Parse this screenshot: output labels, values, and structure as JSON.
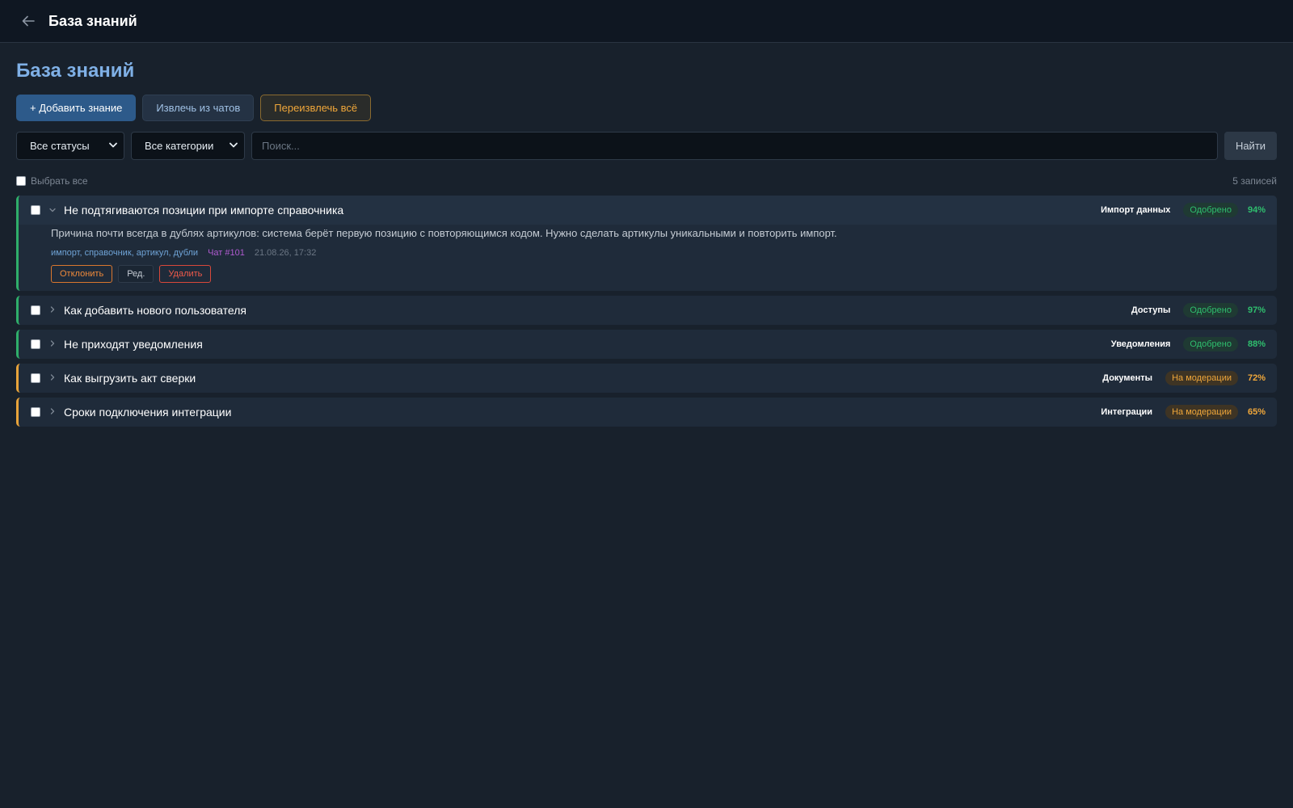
{
  "header": {
    "title": "База знаний"
  },
  "page": {
    "title": "База знаний"
  },
  "actions": {
    "add_label": "+ Добавить знание",
    "extract_label": "Извлечь из чатов",
    "reextract_label": "Переизвлечь всё"
  },
  "filters": {
    "status_value": "Все статусы",
    "category_value": "Все категории",
    "search_placeholder": "Поиск...",
    "find_label": "Найти"
  },
  "list": {
    "select_all_label": "Выбрать все",
    "count_label": "5 записей"
  },
  "items": [
    {
      "title": "Не подтягиваются позиции при импорте справочника",
      "category": "Импорт данных",
      "status": "Одобрено",
      "status_kind": "approved",
      "confidence": "94%",
      "expanded": true,
      "text": "Причина почти всегда в дублях артикулов: система берёт первую позицию с повторяющимся кодом. Нужно сделать артикулы уникальными и повторить импорт.",
      "tags": "импорт, справочник, артикул, дубли",
      "chat": "Чат #101",
      "date": "21.08.26, 17:32",
      "reject_label": "Отклонить",
      "edit_label": "Ред.",
      "delete_label": "Удалить"
    },
    {
      "title": "Как добавить нового пользователя",
      "category": "Доступы",
      "status": "Одобрено",
      "status_kind": "approved",
      "confidence": "97%"
    },
    {
      "title": "Не приходят уведомления",
      "category": "Уведомления",
      "status": "Одобрено",
      "status_kind": "approved",
      "confidence": "88%"
    },
    {
      "title": "Как выгрузить акт сверки",
      "category": "Документы",
      "status": "На модерации",
      "status_kind": "moderation",
      "confidence": "72%"
    },
    {
      "title": "Сроки подключения интеграции",
      "category": "Интеграции",
      "status": "На модерации",
      "status_kind": "moderation",
      "confidence": "65%"
    }
  ],
  "colors": {
    "accent": "#7fb0e6",
    "approved": "#2fbf6e",
    "moderation": "#f0a73a",
    "background": "#18212c"
  },
  "icons": {
    "back": "arrow-left-icon",
    "expand": "chevron-right-icon",
    "collapse": "chevron-down-icon"
  }
}
